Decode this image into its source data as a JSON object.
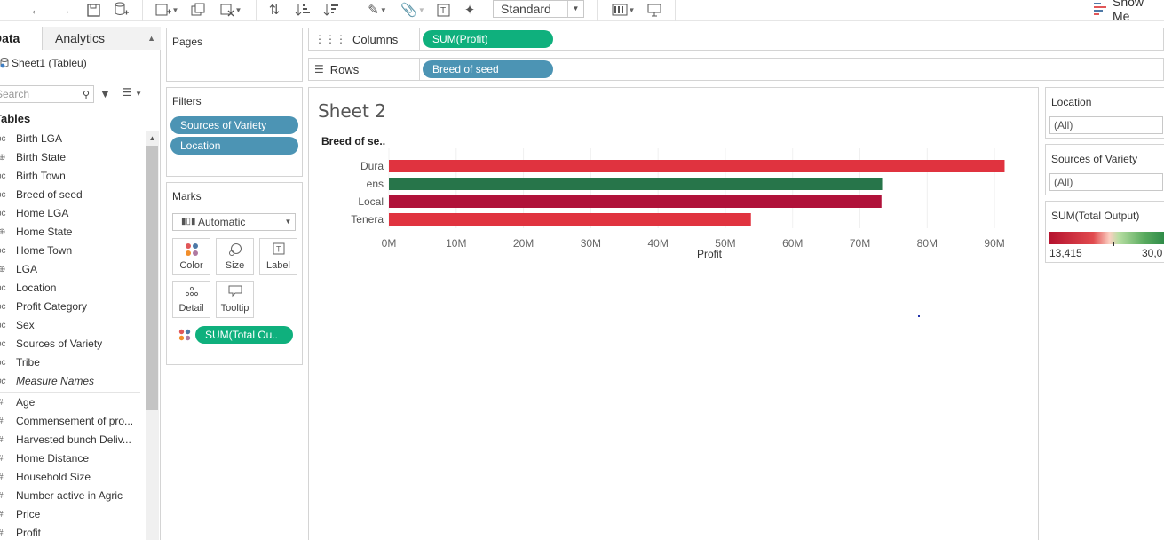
{
  "toolbar": {
    "view_select": "Standard",
    "show_me_label": "Show Me"
  },
  "data_pane": {
    "tab_data": "Data",
    "tab_analytics": "Analytics",
    "datasource": "Sheet1 (Tableu)",
    "search_placeholder": "Search",
    "tables_heading": "Tables",
    "dimensions": [
      {
        "type": "Abc",
        "name": "Birth LGA"
      },
      {
        "type": "geo",
        "name": "Birth State"
      },
      {
        "type": "Abc",
        "name": "Birth Town"
      },
      {
        "type": "Abc",
        "name": "Breed of seed"
      },
      {
        "type": "Abc",
        "name": "Home LGA"
      },
      {
        "type": "geo",
        "name": "Home State"
      },
      {
        "type": "Abc",
        "name": "Home Town"
      },
      {
        "type": "geo",
        "name": "LGA"
      },
      {
        "type": "Abc",
        "name": "Location"
      },
      {
        "type": "Abc",
        "name": "Profit Category"
      },
      {
        "type": "Abc",
        "name": "Sex"
      },
      {
        "type": "Abc",
        "name": "Sources of Variety"
      },
      {
        "type": "Abc",
        "name": "Tribe"
      },
      {
        "type": "Abc",
        "name": "Measure Names"
      }
    ],
    "measures": [
      {
        "type": "#",
        "name": "Age"
      },
      {
        "type": "#",
        "name": "Commensement of pro..."
      },
      {
        "type": "#",
        "name": "Harvested bunch Deliv..."
      },
      {
        "type": "#",
        "name": "Home Distance"
      },
      {
        "type": "#",
        "name": "Household Size"
      },
      {
        "type": "#",
        "name": "Number active in Agric"
      },
      {
        "type": "#",
        "name": "Price"
      },
      {
        "type": "#",
        "name": "Profit"
      }
    ]
  },
  "pages": {
    "title": "Pages"
  },
  "filters": {
    "title": "Filters",
    "pills": [
      "Sources of Variety",
      "Location"
    ]
  },
  "marks": {
    "title": "Marks",
    "type": "Automatic",
    "buttons": [
      "Color",
      "Size",
      "Label",
      "Detail",
      "Tooltip"
    ],
    "color_pill": "SUM(Total Ou.."
  },
  "shelves": {
    "columns_label": "Columns",
    "columns_pill": "SUM(Profit)",
    "rows_label": "Rows",
    "rows_pill": "Breed of seed"
  },
  "worksheet": {
    "title": "Sheet 2"
  },
  "chart_data": {
    "type": "bar",
    "orientation": "horizontal",
    "row_header": "Breed of se..",
    "categories": [
      "Dura",
      "ens",
      "Local",
      "Tenera"
    ],
    "values": [
      91500000,
      73300000,
      73200000,
      53800000
    ],
    "colors": [
      "#e0333f",
      "#27754a",
      "#b0123a",
      "#e0333f"
    ],
    "xlabel": "Profit",
    "xticks": [
      "0M",
      "10M",
      "20M",
      "30M",
      "40M",
      "50M",
      "60M",
      "70M",
      "80M",
      "90M"
    ],
    "xlim": [
      0,
      95000000
    ],
    "grid": true
  },
  "right_pane": {
    "location_title": "Location",
    "location_value": "(All)",
    "sources_title": "Sources of Variety",
    "sources_value": "(All)",
    "legend_title": "SUM(Total Output)",
    "legend_min": "13,415",
    "legend_max": "30,0"
  }
}
